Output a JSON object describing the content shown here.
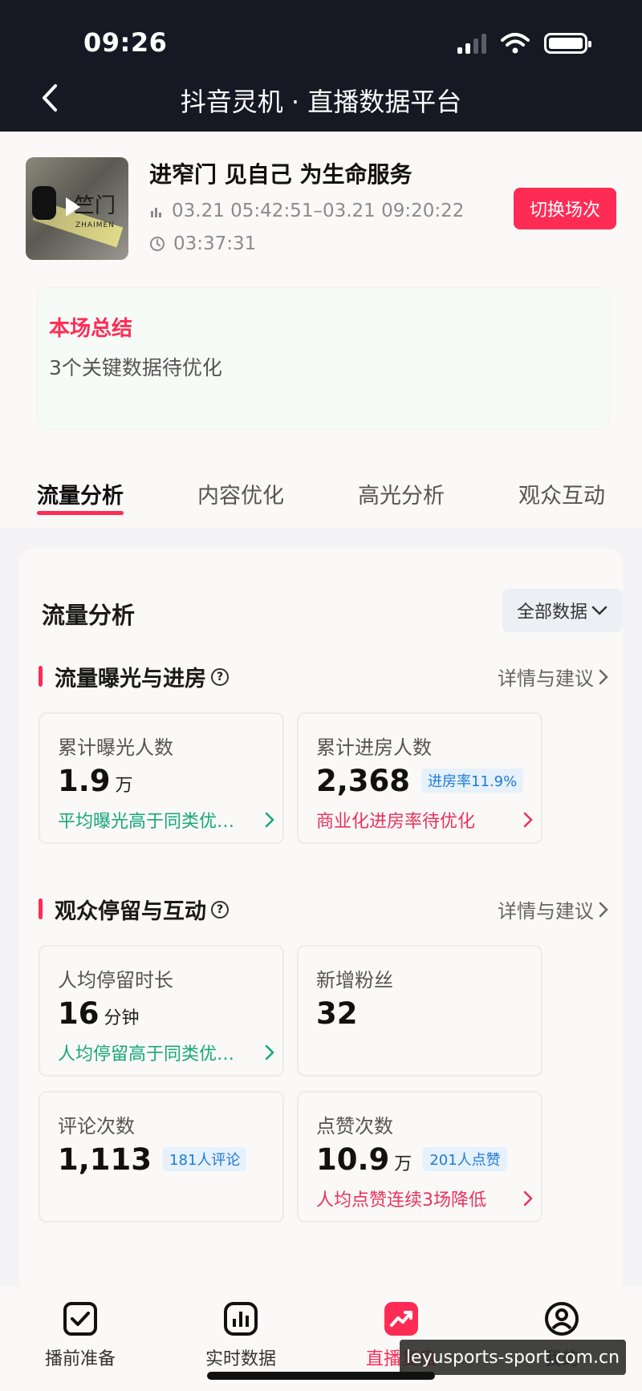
{
  "status_bar": {
    "time": "09:26"
  },
  "nav": {
    "title": "抖音灵机 · 直播数据平台"
  },
  "header": {
    "thumb_text": "竺门",
    "thumb_sub": "ZHAIMEN",
    "live_title": "进窄门 见自己 为生命服务",
    "time_range": "03.21 05:42:51–03.21 09:20:22",
    "duration": "03:37:31",
    "switch_label": "切换场次"
  },
  "summary": {
    "title": "本场总结",
    "subtitle": "3个关键数据待优化"
  },
  "tabs": [
    {
      "label": "流量分析",
      "active": true
    },
    {
      "label": "内容优化",
      "active": false
    },
    {
      "label": "高光分析",
      "active": false
    },
    {
      "label": "观众互动",
      "active": false
    }
  ],
  "main": {
    "title": "流量分析",
    "filter_label": "全部数据",
    "sections": [
      {
        "title": "流量曝光与进房",
        "more": "详情与建议",
        "metrics": [
          {
            "label": "累计曝光人数",
            "value": "1.9",
            "unit": "万",
            "note": "平均曝光高于同类优…",
            "note_color": "green"
          },
          {
            "label": "累计进房人数",
            "value": "2,368",
            "pill": "进房率11.9%",
            "note": "商业化进房率待优化",
            "note_color": "red"
          }
        ]
      },
      {
        "title": "观众停留与互动",
        "more": "详情与建议",
        "metrics": [
          {
            "label": "人均停留时长",
            "value": "16",
            "unit": "分钟",
            "note": "人均停留高于同类优…",
            "note_color": "green"
          },
          {
            "label": "新增粉丝",
            "value": "32"
          },
          {
            "label": "评论次数",
            "value": "1,113",
            "pill": "181人评论"
          },
          {
            "label": "点赞次数",
            "value": "10.9",
            "unit": "万",
            "pill": "201人点赞",
            "note": "人均点赞连续3场降低",
            "note_color": "red"
          }
        ]
      }
    ]
  },
  "bottom_nav": [
    {
      "label": "播前准备",
      "icon": "checkbox-icon",
      "active": false
    },
    {
      "label": "实时数据",
      "icon": "bar-chart-icon",
      "active": false
    },
    {
      "label": "直播复盘",
      "icon": "trend-icon",
      "active": true
    },
    {
      "label": "我的",
      "icon": "user-icon",
      "active": false
    }
  ],
  "watermark": "leyusports-sport.com.cn",
  "colors": {
    "accent": "#fe2c55",
    "dark_bar": "#161823",
    "positive": "#16a87a",
    "info": "#1e7bd6"
  }
}
